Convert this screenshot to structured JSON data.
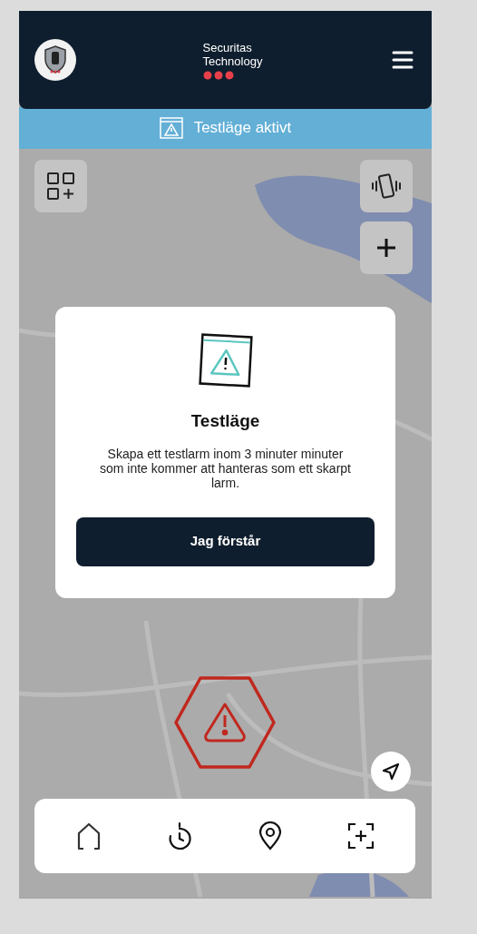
{
  "header": {
    "brand": [
      "Securitas",
      "Technology"
    ],
    "avatar": {
      "kind": "shield"
    },
    "menu": {
      "kind": "hamburger"
    }
  },
  "banner": {
    "text": "Testläge aktivt"
  },
  "map_controls": [
    {
      "kind": "add-widget"
    },
    {
      "kind": "vibrate"
    },
    {
      "kind": "zoom-in"
    },
    {
      "kind": "locate"
    }
  ],
  "alarm_marker": {
    "kind": "warning"
  },
  "modal": {
    "title": "Testläge",
    "message": "Skapa ett testlarm inom 3 minuter minuter som inte kommer att hanteras som ett skarpt larm.",
    "button": "Jag förstår"
  },
  "nav": [
    {
      "kind": "home"
    },
    {
      "kind": "timer"
    },
    {
      "kind": "location"
    },
    {
      "kind": "scan-add"
    }
  ]
}
